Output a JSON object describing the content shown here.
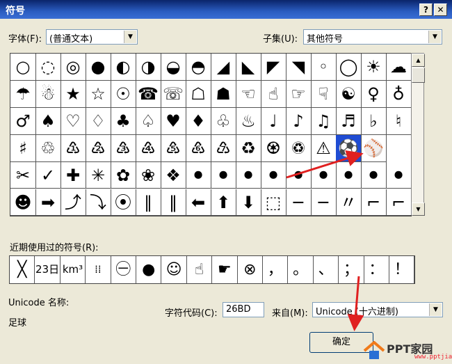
{
  "window": {
    "title": "符号",
    "help_label": "?",
    "close_label": "✕"
  },
  "font": {
    "label": "字体(F):",
    "value": "(普通文本)"
  },
  "subset": {
    "label": "子集(U):",
    "value": "其他符号"
  },
  "symbols": [
    [
      "○",
      "◌",
      "◎",
      "●",
      "◐",
      "◑",
      "◒",
      "◓",
      "◢",
      "◣",
      "◤",
      "◥",
      "◦",
      "◯",
      "☀",
      "☁"
    ],
    [
      "☂",
      "☃",
      "★",
      "☆",
      "☉",
      "☎",
      "☏",
      "☖",
      "☗",
      "☜",
      "☝",
      "☞",
      "☟",
      "☯",
      "♀",
      "♁"
    ],
    [
      "♂",
      "♠",
      "♡",
      "♢",
      "♣",
      "♤",
      "♥",
      "♦",
      "♧",
      "♨",
      "♩",
      "♪",
      "♫",
      "♬",
      "♭",
      "♮"
    ],
    [
      "♯",
      "♲",
      "♳",
      "♴",
      "♵",
      "♶",
      "♷",
      "♸",
      "♹",
      "♻",
      "♼",
      "♽",
      "⚠",
      "⚽",
      "⚾"
    ],
    [
      "✂",
      "✓",
      "✚",
      "✳",
      "✿",
      "❀",
      "❖",
      "⚫",
      "⚫",
      "⚫",
      "⚫",
      "⚫",
      "⚫",
      "⚫",
      "⚫",
      "⚫"
    ],
    [
      "☻",
      "➡",
      "⤴",
      "⤵",
      "⦿",
      "∥",
      "‖",
      "⬅",
      "⬆",
      "⬇",
      "⬚",
      "─",
      "─",
      "〃",
      "⌐",
      "⌐"
    ]
  ],
  "selected_symbol": "⚽",
  "recent": {
    "label": "近期使用过的符号(R):",
    "items": [
      "╳",
      "23日",
      "km³",
      "⁞⁞",
      "㊀",
      "●",
      "☺",
      "☝",
      "☛",
      "⊗",
      "，",
      "。",
      "、",
      "；",
      "：",
      "！"
    ]
  },
  "unicode_name": {
    "label": "Unicode 名称:",
    "value": "足球"
  },
  "char_code": {
    "label": "字符代码(C):",
    "value": "26BD"
  },
  "from": {
    "label": "来自(M):",
    "value": "Unicode (十六进制)"
  },
  "ok_button": "确定",
  "watermark": {
    "brand": "PPT家园",
    "url": "www.pptjia.com"
  },
  "colors": {
    "title_bar": "#0a246a",
    "selection": "#1f4cd3",
    "arrow": "#e02020"
  }
}
